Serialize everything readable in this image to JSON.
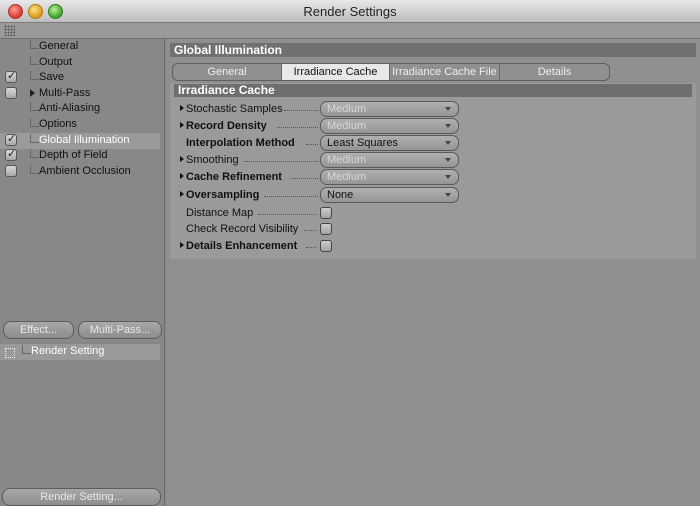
{
  "window": {
    "title": "Render Settings"
  },
  "sidebar": {
    "items": [
      {
        "label": "General",
        "checkbox": null,
        "expandable": false,
        "selected": false
      },
      {
        "label": "Output",
        "checkbox": null,
        "expandable": false,
        "selected": false
      },
      {
        "label": "Save",
        "checkbox": true,
        "expandable": false,
        "selected": false
      },
      {
        "label": "Multi-Pass",
        "checkbox": false,
        "expandable": true,
        "selected": false
      },
      {
        "label": "Anti-Aliasing",
        "checkbox": null,
        "expandable": false,
        "selected": false
      },
      {
        "label": "Options",
        "checkbox": null,
        "expandable": false,
        "selected": false
      },
      {
        "label": "Global Illumination",
        "checkbox": true,
        "expandable": false,
        "selected": true
      },
      {
        "label": "Depth of Field",
        "checkbox": true,
        "expandable": false,
        "selected": false
      },
      {
        "label": "Ambient Occlusion",
        "checkbox": false,
        "expandable": false,
        "selected": false
      }
    ],
    "effect_button": "Effect...",
    "multipass_button": "Multi-Pass...",
    "render_setting_item": "Render Setting",
    "render_setting_button": "Render Setting..."
  },
  "main": {
    "section_title": "Global Illumination",
    "tabs": [
      {
        "label": "General",
        "active": false
      },
      {
        "label": "Irradiance Cache",
        "active": true
      },
      {
        "label": "Irradiance Cache File",
        "active": false
      },
      {
        "label": "Details",
        "active": false
      }
    ],
    "subsection_title": "Irradiance Cache",
    "params": [
      {
        "label": "Stochastic Samples",
        "bold": false,
        "arrow": true,
        "type": "dropdown",
        "value": "Medium",
        "enabled": false
      },
      {
        "label": "Record Density",
        "bold": true,
        "arrow": true,
        "type": "dropdown",
        "value": "Medium",
        "enabled": false
      },
      {
        "label": "Interpolation Method",
        "bold": true,
        "arrow": false,
        "type": "dropdown",
        "value": "Least Squares",
        "enabled": true
      },
      {
        "label": "Smoothing",
        "bold": false,
        "arrow": true,
        "type": "dropdown",
        "value": "Medium",
        "enabled": false
      },
      {
        "label": "Cache Refinement",
        "bold": true,
        "arrow": true,
        "type": "dropdown",
        "value": "Medium",
        "enabled": false
      },
      {
        "label": "Oversampling",
        "bold": true,
        "arrow": true,
        "type": "dropdown",
        "value": "None",
        "enabled": true
      },
      {
        "label": "Distance Map",
        "bold": false,
        "arrow": false,
        "type": "checkbox",
        "value": false
      },
      {
        "label": "Check Record Visibility",
        "bold": false,
        "arrow": false,
        "type": "checkbox",
        "value": false
      },
      {
        "label": "Details Enhancement",
        "bold": true,
        "arrow": true,
        "type": "checkbox",
        "value": false
      }
    ]
  }
}
